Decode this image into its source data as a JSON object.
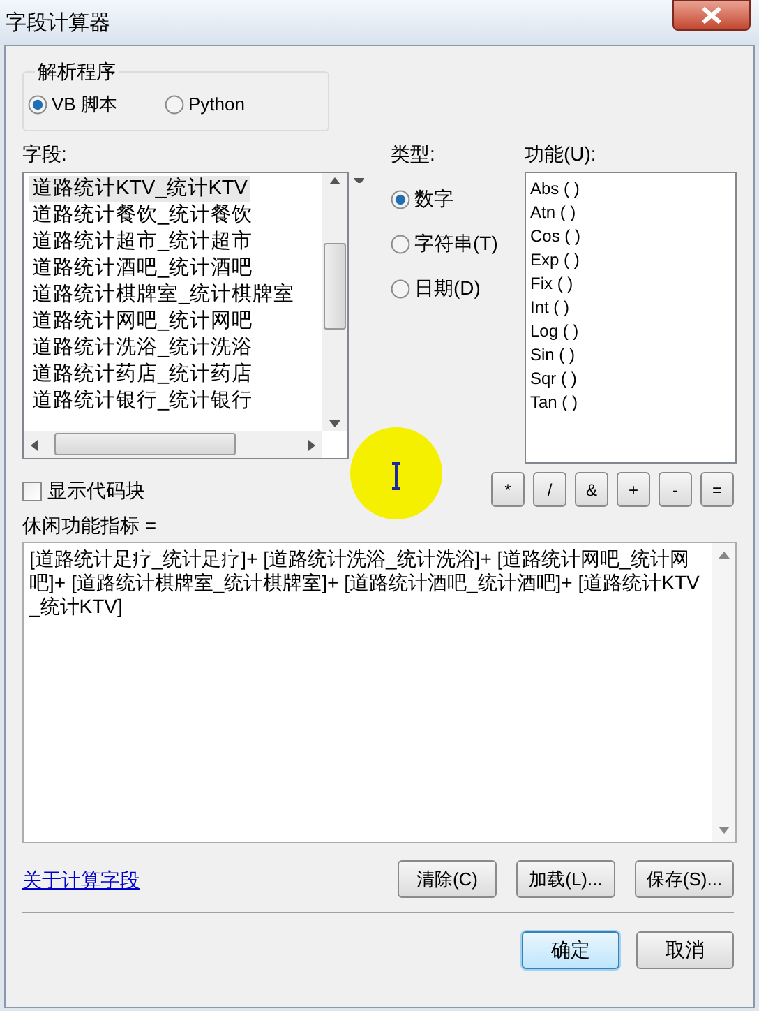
{
  "window": {
    "title": "字段计算器"
  },
  "interpreter": {
    "label": "解析程序",
    "options": [
      {
        "label": "VB 脚本",
        "selected": true
      },
      {
        "label": "Python",
        "selected": false
      }
    ]
  },
  "fields": {
    "label": "字段:",
    "items": [
      {
        "label": "道路统计KTV_统计KTV",
        "selected": true
      },
      {
        "label": "道路统计餐饮_统计餐饮",
        "selected": false
      },
      {
        "label": "道路统计超市_统计超市",
        "selected": false
      },
      {
        "label": "道路统计酒吧_统计酒吧",
        "selected": false
      },
      {
        "label": "道路统计棋牌室_统计棋牌室",
        "selected": false
      },
      {
        "label": "道路统计网吧_统计网吧",
        "selected": false
      },
      {
        "label": "道路统计洗浴_统计洗浴",
        "selected": false
      },
      {
        "label": "道路统计药店_统计药店",
        "selected": false
      },
      {
        "label": "道路统计银行_统计银行",
        "selected": false
      }
    ]
  },
  "type": {
    "label": "类型:",
    "options": [
      {
        "label": "数字",
        "selected": true
      },
      {
        "label": "字符串(T)",
        "selected": false
      },
      {
        "label": "日期(D)",
        "selected": false
      }
    ]
  },
  "functions": {
    "label": "功能(U):",
    "items": [
      "Abs ( )",
      "Atn ( )",
      "Cos ( )",
      "Exp ( )",
      "Fix ( )",
      "Int ( )",
      "Log ( )",
      "Sin ( )",
      "Sqr ( )",
      "Tan ( )"
    ]
  },
  "show_codeblock": {
    "label": "显示代码块",
    "checked": false
  },
  "operators": [
    "*",
    "/",
    "&",
    "+",
    "-",
    "="
  ],
  "expression": {
    "label": "休闲功能指标 =",
    "value": "[道路统计足疗_统计足疗]+ [道路统计洗浴_统计洗浴]+ [道路统计网吧_统计网吧]+ [道路统计棋牌室_统计棋牌室]+ [道路统计酒吧_统计酒吧]+ [道路统计KTV_统计KTV]"
  },
  "about_link": "关于计算字段",
  "file_buttons": [
    "清除(C)",
    "加载(L)...",
    "保存(S)..."
  ],
  "dialog_buttons": [
    {
      "label": "确定",
      "default": true
    },
    {
      "label": "取消",
      "default": false
    }
  ]
}
